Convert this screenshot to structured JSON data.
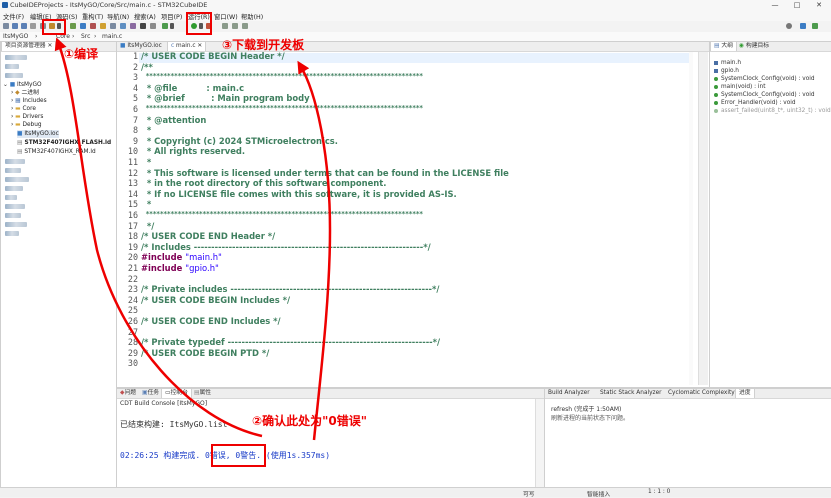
{
  "window": {
    "title": "CubeIDEProjects - ItsMyGO/Core/Src/main.c - STM32CubeIDE",
    "minimize": "—",
    "maximize": "□",
    "close": "✕"
  },
  "menu": [
    "文件(F)",
    "编辑(E)",
    "源码(S)",
    "重构(T)",
    "导航(N)",
    "搜索(A)",
    "项目(P)",
    "运行(R)",
    "窗口(W)",
    "帮助(H)"
  ],
  "breadcrumb": [
    "ItsMyGO",
    "Core",
    "Src",
    "main.c"
  ],
  "project_explorer": {
    "tab_label": "项目资源管理器",
    "tab2_label": "",
    "items": {
      "project": "ItsMyGO",
      "binaries": "二进制",
      "includes": "Includes",
      "core": "Core",
      "drivers": "Drivers",
      "debug": "Debug",
      "ioc": "ItsMyGO.ioc",
      "flash_ld": "STM32F407IGHX_FLASH.ld",
      "ram_ld": "STM32F407IGHX_RAM.ld"
    }
  },
  "editor": {
    "tabs": [
      "ItsMyGO.ioc",
      "main.c"
    ],
    "line_numbers": [
      "1",
      "2",
      "3",
      "4",
      "5",
      "6",
      "7",
      "8",
      "9",
      "10",
      "11",
      "12",
      "13",
      "14",
      "15",
      "16",
      "17",
      "18",
      "19",
      "20",
      "21",
      "22",
      "23",
      "24",
      "25",
      "26",
      "27",
      "28",
      "29",
      "30"
    ],
    "lines": [
      "/* USER CODE BEGIN Header */",
      "/**",
      "  ******************************************************************************",
      "  * @file          : main.c",
      "  * @brief         : Main program body",
      "  ******************************************************************************",
      "  * @attention",
      "  *",
      "  * Copyright (c) 2024 STMicroelectronics.",
      "  * All rights reserved.",
      "  *",
      "  * This software is licensed under terms that can be found in the LICENSE file",
      "  * in the root directory of this software component.",
      "  * If no LICENSE file comes with this software, it is provided AS-IS.",
      "  *",
      "  ******************************************************************************",
      "  */",
      "/* USER CODE END Header */",
      "/* Includes ------------------------------------------------------------------*/",
      "#include ",
      "#include ",
      "",
      "/* Private includes ----------------------------------------------------------*/",
      "/* USER CODE BEGIN Includes */",
      "",
      "/* USER CODE END Includes */",
      "",
      "/* Private typedef -----------------------------------------------------------*/",
      "/* USER CODE BEGIN PTD */",
      ""
    ],
    "include_main": "\"main.h\"",
    "include_gpio": "\"gpio.h\""
  },
  "outline": {
    "tabs": [
      "大纲",
      "构建目标"
    ],
    "items": [
      "main.h",
      "gpio.h",
      "SystemClock_Config(void) : void",
      "main(void) : int",
      "SystemClock_Config(void) : void",
      "Error_Handler(void) : void",
      "assert_failed(uint8_t*, uint32_t) : void"
    ]
  },
  "console": {
    "tabs": [
      "问题",
      "任务",
      "控制台",
      "属性"
    ],
    "header": "CDT Build Console [ItsMyGO]",
    "line1": "已结束构建:  ItsMyGO.list",
    "line2": "02:26:25 构建完成.   0错误, 0警告. (使用1s.357ms)"
  },
  "build_analyzer": {
    "tabs": [
      "Build Analyzer",
      "Static Stack Analyzer",
      "Cyclomatic Complexity",
      "进度"
    ],
    "line1": "refresh (完成于 1:50AM)",
    "line2": "刷新进程的当前状态下问题。"
  },
  "annotations": {
    "compile": "①编译",
    "confirm": "②确认此处为\"0错误\"",
    "download": "③下载到开发板"
  },
  "status": {
    "writable": "可写",
    "insert": "智能插入",
    "position": "1 : 1 : 0"
  },
  "colors": {
    "annotation": "#e00000",
    "comment": "#3f7f5f",
    "keyword": "#7f0055",
    "string": "#2a00ff"
  }
}
